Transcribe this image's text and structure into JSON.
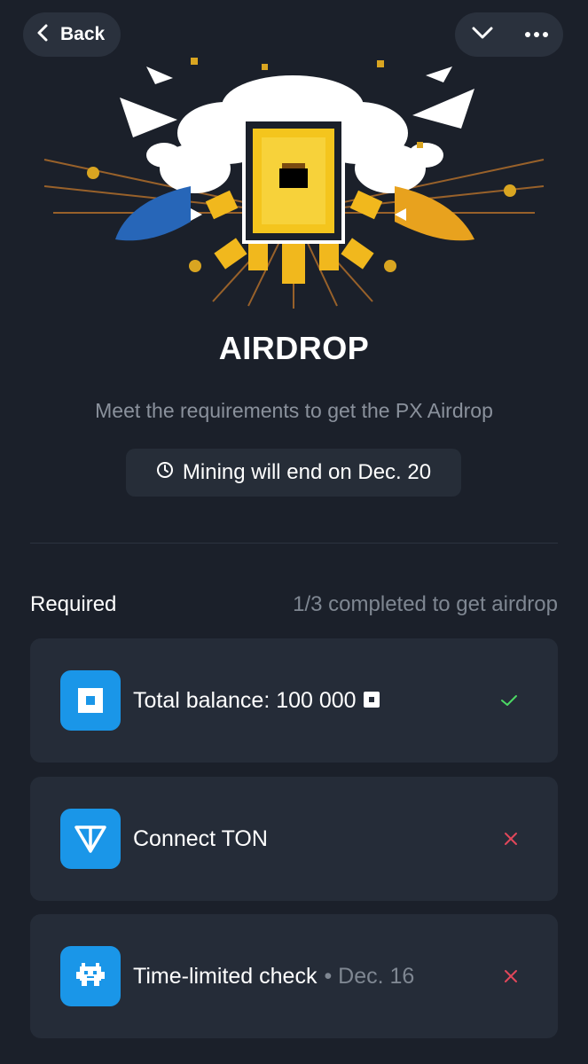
{
  "header": {
    "back_label": "Back"
  },
  "hero": {
    "title": "AIRDROP",
    "subtitle": "Meet the requirements to get the PX Airdrop",
    "mining_notice": "Mining will end on Dec. 20"
  },
  "requirements": {
    "label": "Required",
    "progress_text": "1/3 completed to get airdrop",
    "completed": 1,
    "total": 3,
    "items": [
      {
        "label": "Total balance: 100 000",
        "date": "",
        "icon": "px-coin-icon",
        "status": "done"
      },
      {
        "label": "Connect TON",
        "date": "",
        "icon": "ton-icon",
        "status": "failed"
      },
      {
        "label": "Time-limited check",
        "date": "• Dec. 16",
        "icon": "pixel-creature-icon",
        "status": "failed"
      }
    ]
  },
  "colors": {
    "background": "#1b202a",
    "card": "#252c38",
    "accent_blue": "#1a96e8",
    "success_green": "#4cd964",
    "fail_red": "#e0475a",
    "muted_text": "#8a919c"
  }
}
